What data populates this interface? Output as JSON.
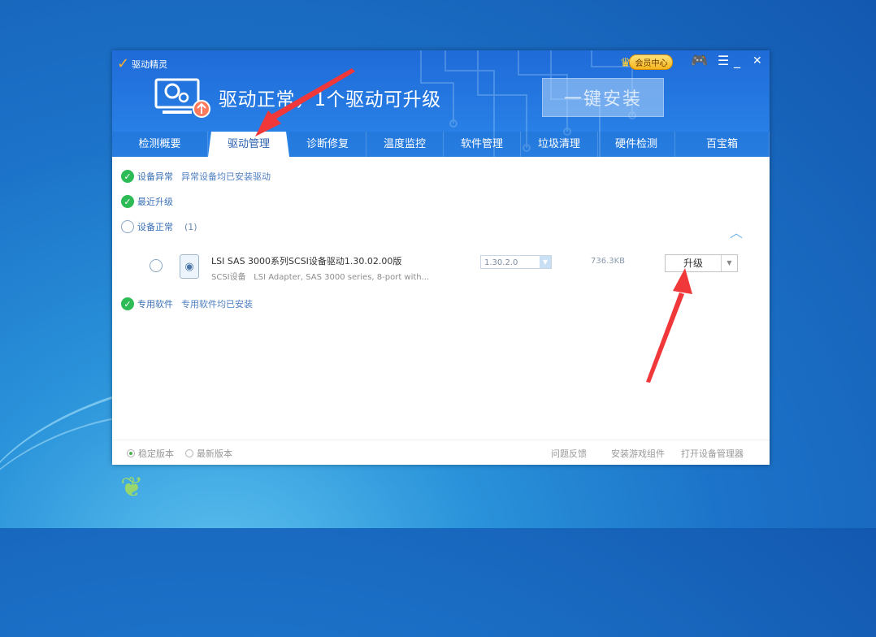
{
  "app": {
    "name": "驱动精灵"
  },
  "header": {
    "status_title": "驱动正常，1个驱动可升级",
    "one_click_label": "一键安装",
    "vip_label": "会员中心",
    "controls": {
      "menu": "☰",
      "minimize": "_",
      "close": "✕"
    }
  },
  "tabs": [
    {
      "label": "检测概要"
    },
    {
      "label": "驱动管理",
      "active": true
    },
    {
      "label": "诊断修复"
    },
    {
      "label": "温度监控"
    },
    {
      "label": "软件管理"
    },
    {
      "label": "垃圾清理"
    },
    {
      "label": "硬件检测"
    },
    {
      "label": "百宝箱"
    }
  ],
  "sections": {
    "abnormal": {
      "title": "设备异常",
      "detail": "异常设备均已安装驱动"
    },
    "recent": {
      "title": "最近升级"
    },
    "normal": {
      "title": "设备正常",
      "count": "(1)"
    },
    "special": {
      "title": "专用软件",
      "detail": "专用软件均已安装"
    }
  },
  "driver": {
    "name": "LSI SAS 3000系列SCSI设备驱动1.30.02.00版",
    "category": "SCSI设备",
    "description": "LSI Adapter, SAS 3000 series, 8-port with...",
    "version_selected": "1.30.2.0",
    "size": "736.3KB",
    "action_label": "升级"
  },
  "footer": {
    "stable_label": "稳定版本",
    "latest_label": "最新版本",
    "feedback": "问题反馈",
    "install_game": "安装游戏组件",
    "open_device_mgr": "打开设备管理器"
  },
  "colors": {
    "header": "#2b86ea",
    "check": "#2dbb55",
    "annotation_arrow": "#f0383a"
  }
}
